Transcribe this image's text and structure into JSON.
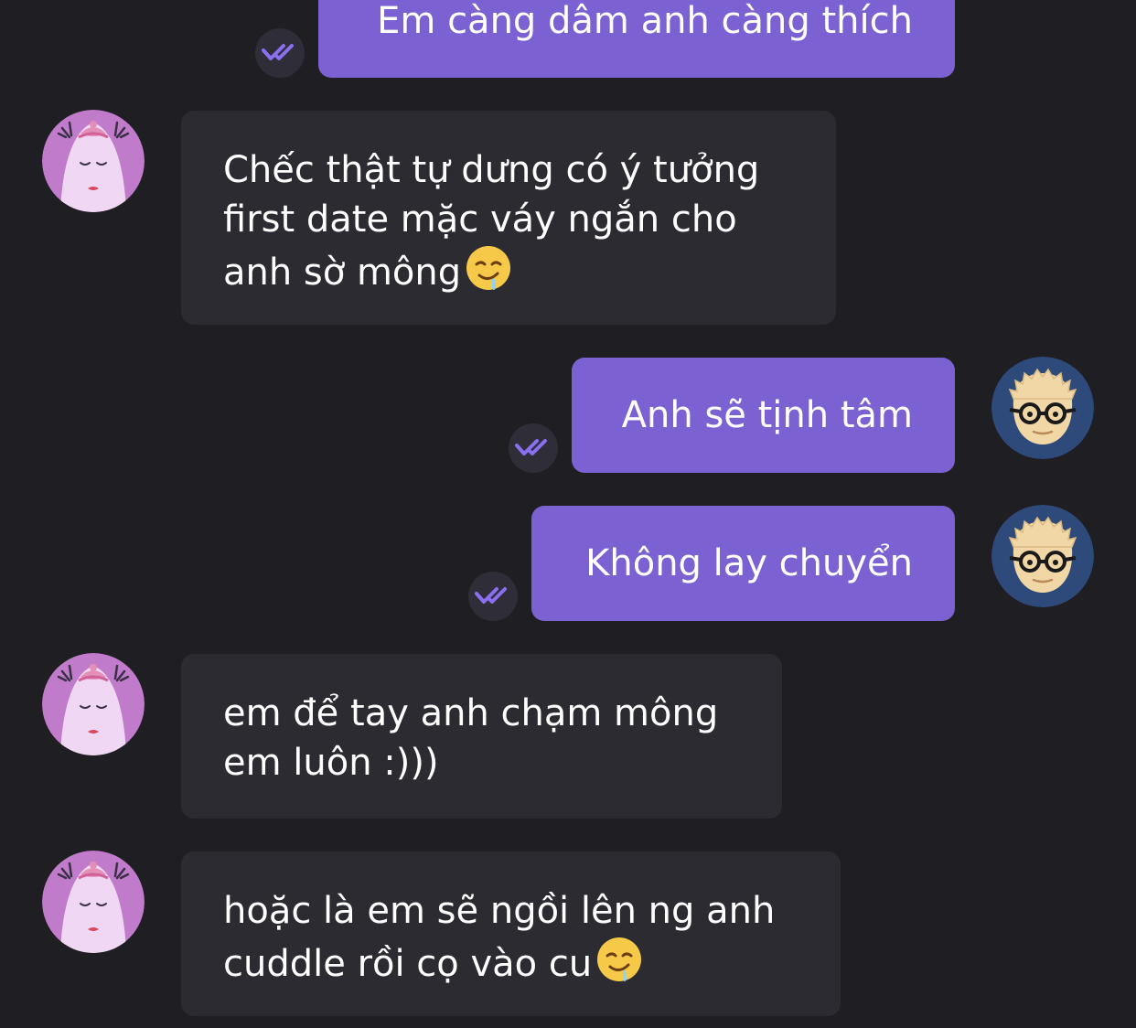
{
  "messages": [
    {
      "direction": "outgoing",
      "text": "Em càng dâm anh càng thích",
      "status": "read"
    },
    {
      "direction": "incoming",
      "text": "Chếc thật tự dưng có ý tưởng\nfirst date mặc váy ngắn cho\nanh sờ mông",
      "emoji": "drooling-face"
    },
    {
      "direction": "outgoing",
      "text": "Anh sẽ tịnh tâm",
      "status": "read"
    },
    {
      "direction": "outgoing",
      "text": "Không lay chuyển",
      "status": "read"
    },
    {
      "direction": "incoming",
      "text": "em để tay anh chạm mông\nem luôn :)))"
    },
    {
      "direction": "incoming",
      "text": "hoặc là em sẽ ngồi lên ng anh\ncuddle rồi cọ vào cu",
      "emoji": "drooling-face"
    }
  ],
  "colors": {
    "background": "#1f1e23",
    "incoming_bubble": "#2c2b31",
    "outgoing_bubble": "#7b61d1",
    "read_check": "#8a6ff0"
  },
  "icons": {
    "read_status": "double-check-icon",
    "incoming_avatar": "pink-character-avatar",
    "outgoing_avatar": "glasses-man-avatar"
  }
}
